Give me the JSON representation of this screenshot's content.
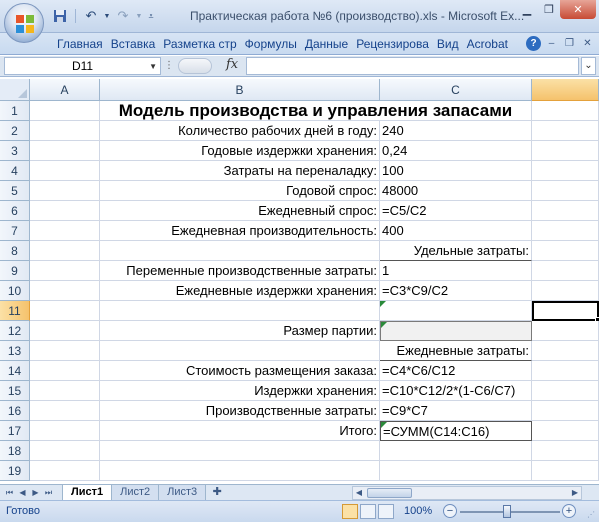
{
  "window": {
    "title": "Практическая работа №6 (производство).xls - Microsoft Ex..."
  },
  "quick_access": {
    "save_icon": "save-icon",
    "undo_icon": "undo-icon",
    "redo_icon": "redo-icon"
  },
  "ribbon": {
    "tabs": [
      "Главная",
      "Вставка",
      "Разметка стр",
      "Формулы",
      "Данные",
      "Рецензирова",
      "Вид",
      "Acrobat"
    ]
  },
  "formula_bar": {
    "name_box": "D11",
    "fx": "fx",
    "content": ""
  },
  "columns": [
    "A",
    "B",
    "C"
  ],
  "rows": [
    {
      "n": "1",
      "b": "Модель производства и управления запасами",
      "c": ""
    },
    {
      "n": "2",
      "b": "Количество рабочих дней в году:",
      "c": "240"
    },
    {
      "n": "3",
      "b": "Годовые издержки хранения:",
      "c": "0,24"
    },
    {
      "n": "4",
      "b": "Затраты на переналадку:",
      "c": "100"
    },
    {
      "n": "5",
      "b": "Годовой спрос:",
      "c": "48000"
    },
    {
      "n": "6",
      "b": "Ежедневный спрос:",
      "c": "=C5/C2"
    },
    {
      "n": "7",
      "b": "Ежедневная производительность:",
      "c": "400"
    },
    {
      "n": "8",
      "b": "",
      "c": "Удельные затраты:"
    },
    {
      "n": "9",
      "b": "Переменные производственные затраты:",
      "c": "1"
    },
    {
      "n": "10",
      "b": "Ежедневные издержки хранения:",
      "c": "=C3*C9/C2"
    },
    {
      "n": "11",
      "b": "",
      "c": ""
    },
    {
      "n": "12",
      "b": "Размер партии:",
      "c": ""
    },
    {
      "n": "13",
      "b": "",
      "c": "Ежедневные затраты:"
    },
    {
      "n": "14",
      "b": "Стоимость размещения заказа:",
      "c": "=C4*C6/C12"
    },
    {
      "n": "15",
      "b": "Издержки хранения:",
      "c": "=C10*C12/2*(1-C6/C7)"
    },
    {
      "n": "16",
      "b": "Производственные затраты:",
      "c": "=C9*C7"
    },
    {
      "n": "17",
      "b": "Итого:",
      "c": "=СУММ(C14:C16)"
    },
    {
      "n": "18",
      "b": "",
      "c": ""
    },
    {
      "n": "19",
      "b": "",
      "c": ""
    }
  ],
  "sheets": [
    "Лист1",
    "Лист2",
    "Лист3"
  ],
  "active_sheet": "Лист1",
  "status": {
    "text": "Готово",
    "zoom": "100%"
  }
}
